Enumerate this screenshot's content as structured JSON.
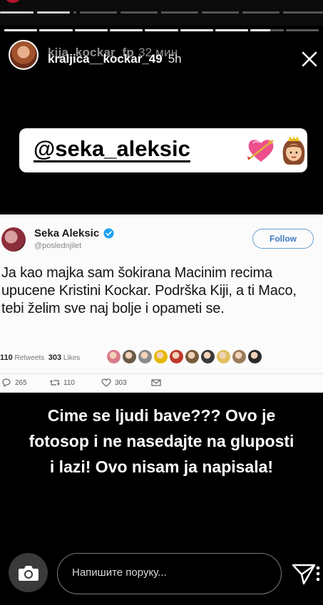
{
  "ghost_header": {
    "username": "kija_kockar_fp",
    "time": "32 мин"
  },
  "story": {
    "username": "kraljica__kockar_49",
    "time": "5h",
    "progress": {
      "segments": 9,
      "completed": 7,
      "current_fraction": 0.6
    }
  },
  "sticker": {
    "mention": "@seka_aleksic"
  },
  "tweet": {
    "name": "Seka Aleksic",
    "handle": "@poslednjilet",
    "follow_label": "Follow",
    "text": "Ja kao majka sam šokirana Macinim recima upucene Kristini Kockar. Podrška Kiji, a ti Maco, tebi želim sve naj bolje i opameti se.",
    "retweets_count": "110",
    "retweets_label": "Retweets",
    "likes_count": "303",
    "likes_label": "Likes",
    "reply_count": "265",
    "retweet_action_count": "110",
    "like_action_count": "303",
    "liker_colors": [
      "#d97b8a",
      "#6b5a4a",
      "#8a8a8a",
      "#e6b800",
      "#c0392b",
      "#7a5a3a",
      "#3a3a3a",
      "#e0c060",
      "#9a7a5a",
      "#2a2a2a"
    ]
  },
  "caption": {
    "text": "Cime se ljudi bave??? Ovo je fotosop i ne nasedajte na gluposti i lazi! Ovo nisam ja napisala!"
  },
  "reply": {
    "placeholder": "Напишите поруку..."
  },
  "colors": {
    "background": "#000000",
    "sticker_bg": "#ffffff",
    "follow_blue": "#3b7bbf",
    "verified_blue": "#1da1f2"
  }
}
